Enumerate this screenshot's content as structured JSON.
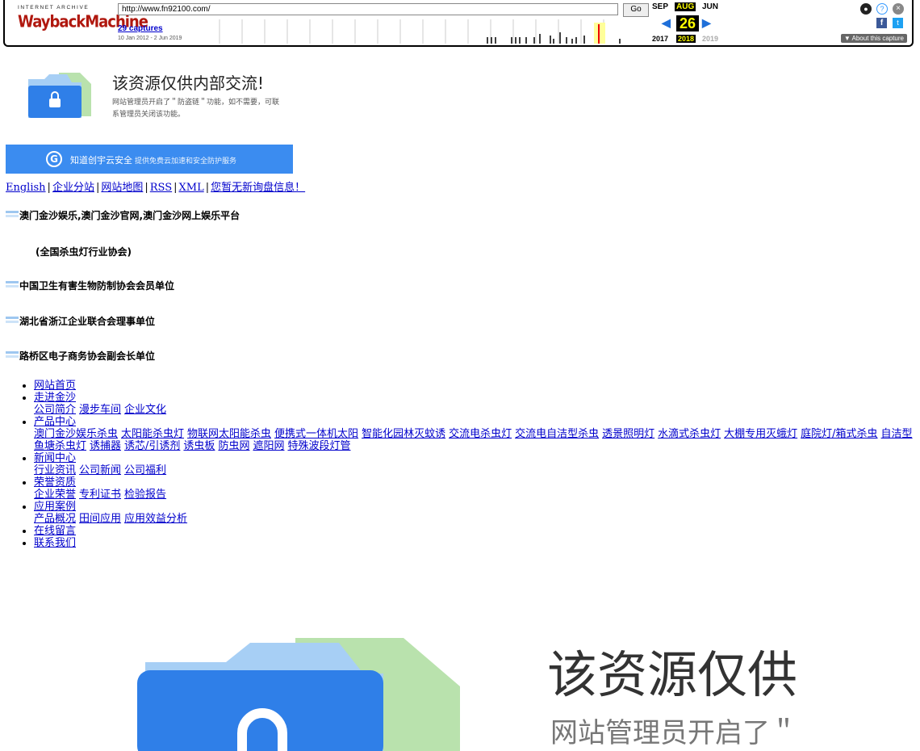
{
  "wayback": {
    "ia_label": "INTERNET ARCHIVE",
    "logo_text": "WaybackMachine",
    "url": "http://www.fn92100.com/",
    "go_label": "Go",
    "captures": "29 captures",
    "date_range": "10 Jan 2012 - 2 Jun 2019",
    "prev_month": "SEP",
    "cur_month": "AUG",
    "next_month": "JUN",
    "day": "26",
    "prev_year": "2017",
    "cur_year": "2018",
    "next_year": "2019",
    "about": "▼ About this capture",
    "sparkline": [
      0,
      0,
      0,
      0,
      0,
      0,
      0,
      0,
      0,
      0,
      0,
      0,
      0,
      0,
      0,
      0,
      0,
      0,
      0,
      0,
      0,
      0,
      0,
      0,
      0,
      0,
      0,
      0,
      0,
      0,
      0,
      0,
      0,
      0,
      0,
      0,
      0,
      0,
      0,
      0,
      0,
      0,
      0,
      0,
      0,
      0,
      0,
      0,
      0,
      0,
      0,
      0,
      0,
      0,
      0,
      0,
      0,
      0,
      0,
      0,
      0,
      0,
      0,
      0,
      0,
      0,
      0,
      0,
      0,
      0,
      0,
      0,
      0,
      0,
      0,
      0,
      0,
      0,
      0,
      0,
      0,
      0,
      0,
      0,
      0,
      0,
      0,
      0,
      0,
      0,
      0,
      0,
      0,
      0,
      0,
      0,
      0,
      0,
      0,
      0,
      0,
      0,
      0,
      0,
      0,
      0,
      0,
      0,
      0,
      0,
      0,
      0,
      0,
      0,
      0,
      0,
      0,
      0,
      0,
      0,
      0,
      0,
      0,
      0,
      0,
      0,
      0,
      0,
      0,
      0,
      0,
      0,
      0,
      0,
      0,
      0,
      0,
      0,
      0,
      0,
      0,
      0,
      0,
      0,
      0,
      0,
      0,
      0,
      0,
      0,
      0,
      0,
      0,
      0,
      0,
      0,
      0,
      0,
      0,
      0,
      0,
      0,
      0,
      0,
      0,
      0,
      0,
      0,
      0,
      0,
      0,
      0,
      0,
      0,
      0,
      0,
      0,
      0,
      0,
      0,
      0,
      0,
      0,
      0,
      0,
      0,
      0,
      0,
      0,
      0,
      0,
      0,
      0,
      0,
      0,
      0,
      0,
      0,
      0,
      0,
      0,
      0,
      0,
      0,
      0,
      0,
      0,
      0,
      0,
      0,
      0,
      0,
      0,
      0,
      0,
      0,
      0,
      0,
      0,
      0,
      0,
      0,
      0,
      0,
      0,
      0,
      0,
      0,
      0,
      0,
      0,
      0,
      0,
      0,
      0,
      0,
      0,
      0,
      0,
      0,
      0,
      0,
      0,
      0,
      0,
      0,
      0,
      0,
      0,
      0,
      0,
      0,
      0,
      0,
      0,
      0,
      0,
      0,
      0,
      0,
      0,
      0,
      0,
      0,
      0,
      0,
      0,
      0,
      0,
      0,
      0,
      0,
      0,
      0,
      0,
      0,
      0,
      0,
      0,
      0,
      0,
      0,
      0,
      0,
      0,
      0,
      0,
      0,
      0,
      0,
      0,
      0,
      0,
      0,
      0,
      0,
      0,
      0,
      0,
      0,
      0,
      0,
      0,
      0,
      0,
      0,
      0,
      0,
      0,
      0,
      0,
      0,
      0,
      0,
      0,
      0,
      0,
      0,
      0,
      0,
      0,
      0,
      0,
      0,
      0,
      0,
      0,
      0,
      0,
      0,
      0,
      0,
      0,
      0,
      0,
      0,
      0,
      0,
      0,
      0,
      0,
      0,
      0,
      0,
      0,
      0,
      0,
      0,
      0,
      0,
      0,
      0,
      0,
      0,
      0,
      0,
      0,
      0,
      0,
      0,
      0,
      0,
      0,
      0,
      0,
      0,
      0,
      0,
      0,
      0,
      0,
      0,
      0,
      0,
      0,
      0,
      0,
      0,
      0,
      0,
      0,
      0,
      0,
      0,
      0,
      0,
      0,
      0,
      0,
      0,
      0,
      0,
      0,
      0,
      0,
      0,
      0,
      0,
      0,
      0,
      0,
      0,
      0,
      0,
      0,
      0,
      0,
      0,
      0,
      0,
      0,
      0,
      0,
      0,
      0,
      0,
      0,
      0,
      0,
      0,
      0,
      0,
      0,
      0,
      0,
      0,
      0,
      0,
      0,
      0,
      0,
      0,
      0,
      0,
      0,
      0,
      0,
      0,
      0,
      0,
      0,
      0,
      0,
      0,
      0,
      0,
      0,
      0,
      0,
      0,
      0,
      0,
      0,
      0,
      0,
      0,
      0,
      0,
      0,
      0,
      0,
      0,
      0,
      0,
      0,
      0,
      0,
      0,
      0,
      0,
      0,
      0,
      0,
      0,
      0,
      0,
      0,
      0,
      0,
      0,
      0,
      0,
      0,
      0,
      0,
      0,
      0,
      0,
      0,
      0,
      0,
      0,
      0,
      0,
      0,
      0,
      0,
      0,
      0,
      0,
      0,
      0,
      0,
      0,
      0,
      0,
      0,
      0,
      0,
      0,
      0,
      0,
      0,
      0,
      0,
      0,
      0,
      0,
      0,
      0,
      0,
      0,
      0,
      0,
      0,
      0,
      0,
      0,
      0,
      0,
      0,
      0,
      0,
      0,
      0,
      0,
      0,
      0,
      0,
      0,
      0,
      0,
      0,
      0,
      0,
      0,
      0,
      0,
      0,
      0,
      0,
      0,
      0,
      0,
      0,
      0,
      0,
      0,
      0,
      0,
      0,
      0,
      0,
      0,
      0,
      0,
      0,
      0,
      0,
      0,
      0,
      0,
      0,
      0,
      0,
      0,
      0,
      0,
      0,
      0,
      0,
      0,
      0,
      0,
      0,
      0,
      0,
      0,
      0,
      0,
      0,
      0,
      0,
      0,
      0,
      0,
      0,
      0,
      0,
      0,
      0,
      0,
      0,
      0,
      0,
      0,
      0,
      0,
      0,
      0,
      0,
      0,
      0,
      0,
      0,
      0,
      0,
      0,
      0,
      0,
      0,
      0,
      0,
      0,
      0,
      0,
      0,
      0,
      0,
      0,
      0,
      0,
      0,
      0,
      0,
      0,
      0,
      0,
      0,
      0,
      0,
      0,
      0,
      0,
      0,
      0,
      0,
      0,
      0,
      0,
      0,
      0,
      0,
      0,
      0,
      0,
      0,
      0
    ]
  },
  "notice": {
    "title": "该资源仅供内部交流!",
    "desc": "网站管理员开启了＂防盗链＂功能，如不需要，可联系管理员关闭该功能。",
    "banner_brand": "知道创宇云安全",
    "banner_sub": "提供免费云加速和安全防护服务"
  },
  "toplinks": [
    "English",
    "企业分站",
    "网站地图",
    "RSS",
    "XML",
    "您暂无新询盘信息！"
  ],
  "headings": [
    "澳门金沙娱乐,澳门金沙官网,澳门金沙网上娱乐平台",
    "中国卫生有害生物防制协会会员单位",
    "湖北省浙江企业联合会理事单位",
    "路桥区电子商务协会副会长单位"
  ],
  "sub_assoc": "(全国杀虫灯行业协会)",
  "nav": [
    {
      "label": "网站首页",
      "subs": []
    },
    {
      "label": "走进金沙",
      "subs": [
        "公司简介",
        "漫步车间",
        "企业文化"
      ]
    },
    {
      "label": "产品中心",
      "subs": [
        "澳门金沙娱乐杀虫",
        "太阳能杀虫灯",
        "物联网太阳能杀虫",
        "便携式一体机太阳",
        "智能化园林灭蚊诱",
        "交流电杀虫灯",
        "交流电自洁型杀虫",
        "透景照明灯",
        "水滴式杀虫灯",
        "大棚专用灭蛾灯",
        "庭院灯/箱式杀虫",
        "自洁型鱼塘杀虫灯",
        "诱捕器",
        "诱芯/引诱剂",
        "诱虫板",
        "防虫网",
        "遮阳网",
        "特殊波段灯管"
      ]
    },
    {
      "label": "新闻中心",
      "subs": [
        "行业资讯",
        "公司新闻",
        "公司福利"
      ]
    },
    {
      "label": "荣誉资质",
      "subs": [
        "企业荣誉",
        "专利证书",
        "检验报告"
      ]
    },
    {
      "label": "应用案例",
      "subs": [
        "产品概况",
        "田间应用",
        "应用效益分析"
      ]
    },
    {
      "label": "在线留言",
      "subs": []
    },
    {
      "label": "联系我们",
      "subs": []
    }
  ],
  "big": {
    "title": "该资源仅供",
    "desc": "网站管理员开启了＂"
  }
}
